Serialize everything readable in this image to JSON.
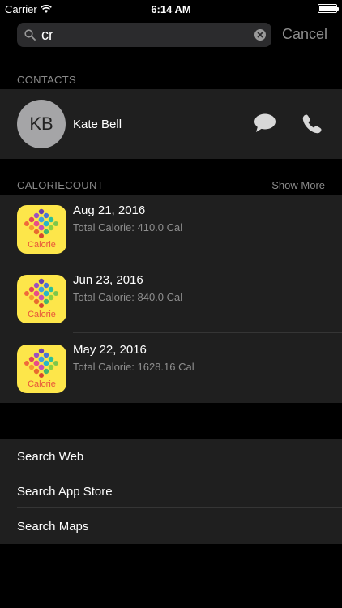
{
  "status_bar": {
    "carrier": "Carrier",
    "time": "6:14 AM",
    "battery_level": 1.0
  },
  "search": {
    "query": "cr",
    "cancel_label": "Cancel"
  },
  "contacts": {
    "header": "CONTACTS",
    "items": [
      {
        "initials": "KB",
        "name": "Kate Bell"
      }
    ]
  },
  "caloriecount": {
    "header": "CALORIECOUNT",
    "show_more": "Show More",
    "app_icon_text": "Calorie",
    "items": [
      {
        "date": "Aug 21, 2016",
        "total": "Total Calorie: 410.0 Cal"
      },
      {
        "date": "Jun 23, 2016",
        "total": "Total Calorie: 840.0 Cal"
      },
      {
        "date": "May 22, 2016",
        "total": "Total Calorie: 1628.16 Cal"
      }
    ]
  },
  "links": [
    {
      "label": "Search Web"
    },
    {
      "label": "Search App Store"
    },
    {
      "label": "Search Maps"
    }
  ],
  "colors": {
    "background": "#000000",
    "panel": "#1f1f1f",
    "secondary_text": "#8e8e8e",
    "app_icon_bg": "#fde64a"
  }
}
